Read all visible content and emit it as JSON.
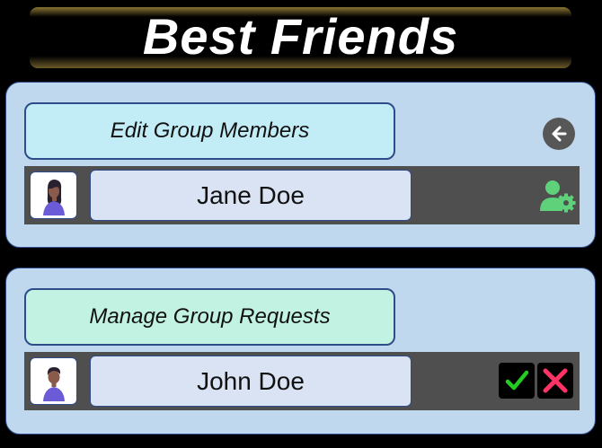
{
  "header": {
    "title": "Best Friends"
  },
  "edit_section": {
    "button_label": "Edit Group Members",
    "back_icon": "arrow-left-circle-icon",
    "members": [
      {
        "name": "Jane Doe",
        "action_icon": "user-settings-icon"
      }
    ]
  },
  "requests_section": {
    "button_label": "Manage Group Requests",
    "requests": [
      {
        "name": "John Doe",
        "accept_icon": "check-icon",
        "reject_icon": "x-icon"
      }
    ]
  },
  "colors": {
    "panel_bg": "#c0d8ed",
    "panel_border": "#2e4b8a",
    "edit_button_bg": "#c2edf6",
    "manage_button_bg": "#c2f2e2",
    "row_bg": "#4f4f4f",
    "name_box_bg": "#d9e3f4",
    "settings_icon": "#5fd17a",
    "accept_icon": "#22cc22",
    "reject_icon": "#ff3366"
  }
}
